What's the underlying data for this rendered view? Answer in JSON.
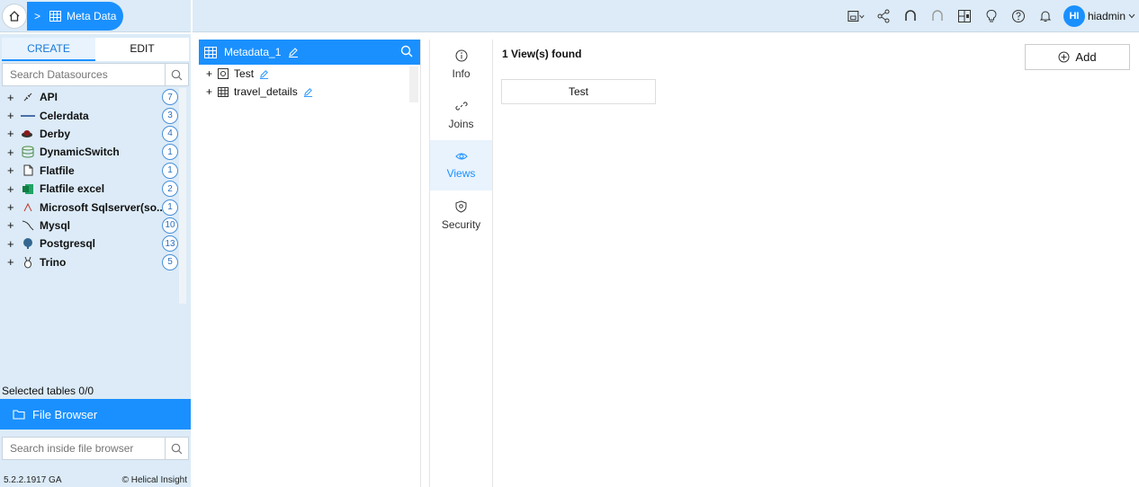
{
  "breadcrumb": {
    "current": "Meta Data"
  },
  "user": {
    "initials": "HI",
    "name": "hiadmin"
  },
  "left_panel": {
    "tabs": [
      {
        "label": "CREATE"
      },
      {
        "label": "EDIT"
      }
    ],
    "search_placeholder": "Search Datasources",
    "datasources": [
      {
        "name": "API",
        "count": "7",
        "icon": "api-icon"
      },
      {
        "name": "Celerdata",
        "count": "3",
        "icon": "celerdata-icon"
      },
      {
        "name": "Derby",
        "count": "4",
        "icon": "derby-icon"
      },
      {
        "name": "DynamicSwitch",
        "count": "1",
        "icon": "database-icon"
      },
      {
        "name": "Flatfile",
        "count": "1",
        "icon": "file-icon"
      },
      {
        "name": "Flatfile excel",
        "count": "2",
        "icon": "excel-icon"
      },
      {
        "name": "Microsoft Sqlserver(so...",
        "count": "1",
        "icon": "sqlserver-icon"
      },
      {
        "name": "Mysql",
        "count": "10",
        "icon": "mysql-icon"
      },
      {
        "name": "Postgresql",
        "count": "13",
        "icon": "postgresql-icon"
      },
      {
        "name": "Trino",
        "count": "5",
        "icon": "trino-icon"
      }
    ],
    "selected_tables": "Selected tables 0/0",
    "file_browser_label": "File Browser",
    "file_browser_placeholder": "Search inside file browser",
    "version": "5.2.2.1917 GA",
    "brand": "Helical Insight"
  },
  "metadata_panel": {
    "title": "Metadata_1",
    "items": [
      {
        "name": "Test",
        "icon": "view-icon"
      },
      {
        "name": "travel_details",
        "icon": "table-icon"
      }
    ]
  },
  "side_tabs": [
    {
      "label": "Info",
      "icon": "info-icon"
    },
    {
      "label": "Joins",
      "icon": "link-icon"
    },
    {
      "label": "Views",
      "icon": "eye-icon"
    },
    {
      "label": "Security",
      "icon": "shield-icon"
    }
  ],
  "content": {
    "found_text": "1 View(s) found",
    "add_label": "Add",
    "views": [
      {
        "name": "Test"
      }
    ]
  },
  "colors": {
    "accent": "#1a90ff",
    "panel_bg": "#dcebf7"
  }
}
